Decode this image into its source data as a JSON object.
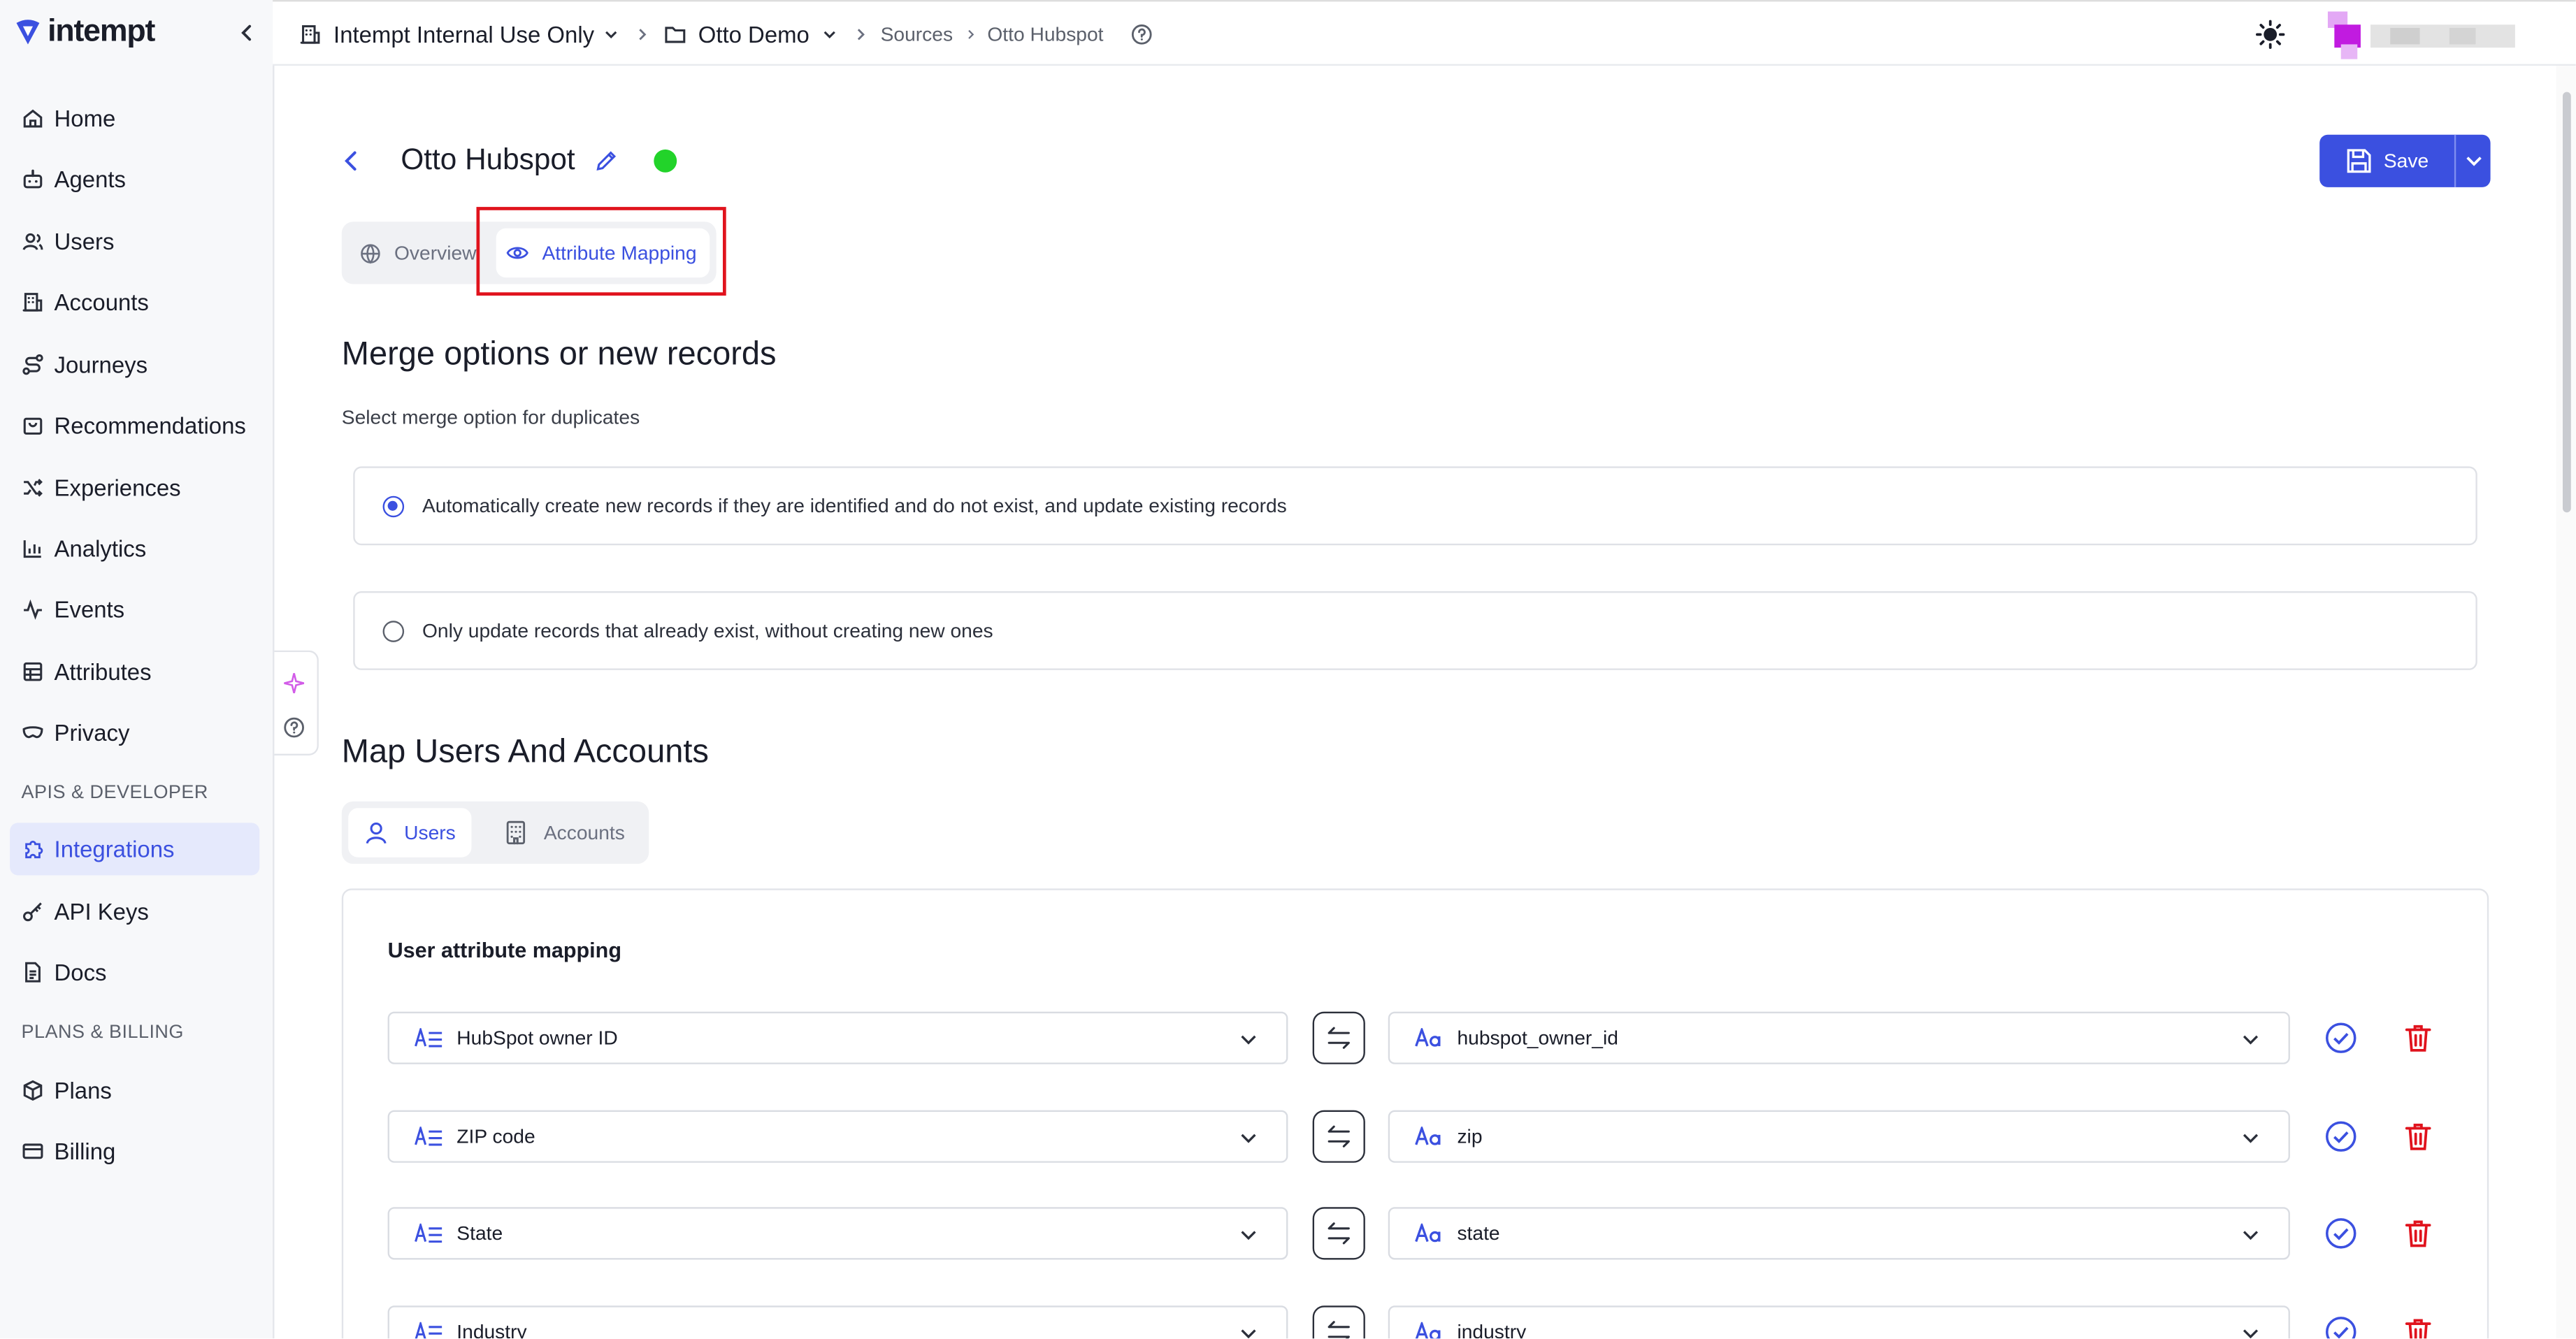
{
  "app": {
    "logo_text": "intempt"
  },
  "sidebar": {
    "items": [
      {
        "label": "Home",
        "icon": "home-icon"
      },
      {
        "label": "Agents",
        "icon": "bot-icon"
      },
      {
        "label": "Users",
        "icon": "users-icon"
      },
      {
        "label": "Accounts",
        "icon": "building-icon"
      },
      {
        "label": "Journeys",
        "icon": "route-icon"
      },
      {
        "label": "Recommendations",
        "icon": "bag-icon"
      },
      {
        "label": "Experiences",
        "icon": "shuffle-icon"
      },
      {
        "label": "Analytics",
        "icon": "bar-chart-icon"
      },
      {
        "label": "Events",
        "icon": "activity-icon"
      },
      {
        "label": "Attributes",
        "icon": "table-icon"
      },
      {
        "label": "Privacy",
        "icon": "mask-icon"
      }
    ],
    "section_apis": "APIS & DEVELOPER",
    "dev_items": [
      {
        "label": "Integrations",
        "icon": "puzzle-icon",
        "active": true
      },
      {
        "label": "API Keys",
        "icon": "key-icon"
      },
      {
        "label": "Docs",
        "icon": "document-icon"
      }
    ],
    "section_billing": "PLANS & BILLING",
    "billing_items": [
      {
        "label": "Plans",
        "icon": "package-icon"
      },
      {
        "label": "Billing",
        "icon": "credit-card-icon"
      }
    ]
  },
  "breadcrumb": {
    "org": "Intempt Internal Use Only",
    "project": "Otto Demo",
    "sources": "Sources",
    "current": "Otto Hubspot"
  },
  "page": {
    "title": "Otto Hubspot",
    "status_color": "#22d32a",
    "save_label": "Save"
  },
  "tabs": [
    {
      "label": "Overview",
      "icon": "globe-icon",
      "active": false
    },
    {
      "label": "Attribute Mapping",
      "icon": "eye-icon",
      "active": true
    }
  ],
  "merge": {
    "heading": "Merge options or new records",
    "subheading": "Select merge option for duplicates",
    "options": [
      {
        "label": "Automatically create new records if they are identified and do not exist, and update existing records",
        "selected": true
      },
      {
        "label": "Only update records that already exist, without creating new ones",
        "selected": false
      }
    ]
  },
  "mapping": {
    "heading": "Map Users And Accounts",
    "segments": [
      {
        "label": "Users",
        "active": true
      },
      {
        "label": "Accounts",
        "active": false
      }
    ],
    "panel_title": "User attribute mapping",
    "rows": [
      {
        "source": "HubSpot owner ID",
        "target": "hubspot_owner_id"
      },
      {
        "source": "ZIP code",
        "target": "zip"
      },
      {
        "source": "State",
        "target": "state"
      },
      {
        "source": "Industry",
        "target": "industry"
      }
    ]
  },
  "colors": {
    "accent": "#3b50e0",
    "danger": "#e0131d",
    "highlight_box": "#e0131d"
  }
}
